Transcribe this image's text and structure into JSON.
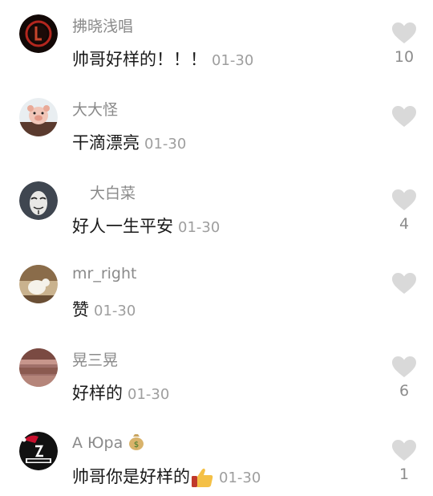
{
  "comments": [
    {
      "username": "拂晓浅唱",
      "text": "帅哥好样的！！！",
      "date": "01-30",
      "likes": "10",
      "avatar_icon": "red-ring-avatar-icon"
    },
    {
      "username": "大大怪",
      "text": "干滴漂亮",
      "date": "01-30",
      "likes": "",
      "avatar_icon": "pig-plush-avatar-icon"
    },
    {
      "username": "大白菜",
      "text": "好人一生平安",
      "date": "01-30",
      "likes": "4",
      "avatar_icon": "mask-avatar-icon"
    },
    {
      "username": "mr_right",
      "text": "赞",
      "date": "01-30",
      "likes": "",
      "avatar_icon": "photo-avatar-icon"
    },
    {
      "username": "晃三晃",
      "text": "好样的",
      "date": "01-30",
      "likes": "6",
      "avatar_icon": "sepia-photo-avatar-icon"
    },
    {
      "username": "A Юра",
      "text": "帅哥你是好样的",
      "date": "01-30",
      "likes": "1",
      "avatar_icon": "slash-logo-avatar-icon",
      "username_emoji": "money-bag-icon",
      "text_emoji": "thumbs-up-icon"
    }
  ],
  "colors": {
    "heart": "#d9d9d9",
    "username": "#8a8a8a",
    "text": "#1a1a1a",
    "date": "#9e9e9e"
  }
}
